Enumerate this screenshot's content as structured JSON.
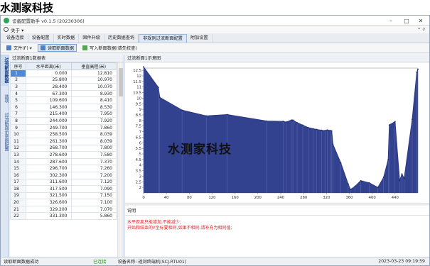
{
  "watermark_top": "水测家科技",
  "watermark_overlay": "水测家科技",
  "window": {
    "title": "设备配置助手 v0.1.5 (20230306)",
    "controls": {
      "minimize": "–",
      "maximize": "□",
      "close": "✕"
    }
  },
  "menu": {
    "about": "关于 ▾",
    "chevron": "⌃  ?"
  },
  "tabs": [
    "设备连接",
    "设备配置",
    "实时数据",
    "固件升级",
    "历史数据查询",
    "非规则过流断面配置",
    "附加设置"
  ],
  "toolbar": {
    "file": "文件(F) ▾",
    "read": "读取断面数据",
    "write": "写入断面数据(请先校查)"
  },
  "vtabs": [
    "过流断面数据",
    "选项",
    "过流断面示意图配置"
  ],
  "table": {
    "panel_title": "过流断面1数据表",
    "headers": [
      "序号",
      "水平距离(米)",
      "垂直高程(米)"
    ],
    "rows": [
      [
        "1",
        "0.000",
        "12.810"
      ],
      [
        "2",
        "25.800",
        "10.970"
      ],
      [
        "3",
        "28.400",
        "10.070"
      ],
      [
        "4",
        "67.300",
        "8.930"
      ],
      [
        "5",
        "109.600",
        "8.410"
      ],
      [
        "6",
        "146.300",
        "8.530"
      ],
      [
        "7",
        "215.400",
        "7.950"
      ],
      [
        "8",
        "244.000",
        "7.920"
      ],
      [
        "9",
        "249.700",
        "7.860"
      ],
      [
        "10",
        "258.500",
        "8.039"
      ],
      [
        "11",
        "261.300",
        "8.039"
      ],
      [
        "12",
        "268.700",
        "7.800"
      ],
      [
        "13",
        "278.600",
        "7.580"
      ],
      [
        "14",
        "287.600",
        "7.370"
      ],
      [
        "15",
        "296.700",
        "7.260"
      ],
      [
        "16",
        "302.300",
        "7.200"
      ],
      [
        "17",
        "311.600",
        "7.120"
      ],
      [
        "18",
        "317.500",
        "7.090"
      ],
      [
        "19",
        "321.500",
        "7.150"
      ],
      [
        "20",
        "326.600",
        "7.100"
      ],
      [
        "21",
        "329.200",
        "7.070"
      ],
      [
        "22",
        "331.300",
        "5.860"
      ]
    ]
  },
  "chart_panel_title": "过流断面1示意图",
  "chart_data": {
    "type": "area",
    "x": [
      0,
      25.8,
      28.4,
      67.3,
      109.6,
      146.3,
      215.4,
      244.0,
      249.7,
      258.5,
      261.3,
      268.7,
      278.6,
      287.6,
      296.7,
      302.3,
      311.6,
      317.5,
      321.5,
      326.6,
      329.2,
      331.3,
      345,
      358,
      362,
      370,
      380,
      395,
      410,
      420,
      428,
      430,
      440,
      448,
      452,
      456,
      470,
      478,
      480
    ],
    "y": [
      12.81,
      10.97,
      10.07,
      8.93,
      8.41,
      8.53,
      7.95,
      7.92,
      7.86,
      8.039,
      8.039,
      7.8,
      7.58,
      7.37,
      7.26,
      7.2,
      7.12,
      7.09,
      7.15,
      7.1,
      7.07,
      5.86,
      4.2,
      2.3,
      1.8,
      2.1,
      2.6,
      2.4,
      2.0,
      2.9,
      4.5,
      7.6,
      7.9,
      2.6,
      3.2,
      2.8,
      8.1,
      12.3,
      12.6
    ],
    "xlim": [
      0,
      480
    ],
    "ylim": [
      1.5,
      12.7
    ],
    "xticks": [
      0,
      40,
      80,
      120,
      160,
      200,
      240,
      280,
      320,
      360,
      400,
      440
    ],
    "yticks": [
      2,
      2.5,
      3,
      3.5,
      4,
      4.5,
      5,
      5.5,
      6,
      6.5,
      7,
      7.5,
      8,
      8.5,
      9,
      9.5,
      10,
      10.5,
      11,
      11.5,
      12,
      12.5
    ],
    "fill_color": "#33428f",
    "line_color": "#2a3a86"
  },
  "description": {
    "title": "说明",
    "lines": [
      "水平距离只能增加,不能减少;",
      "开始和结束的Y坐标要相同,如果不相同,请补充为相同值;"
    ]
  },
  "status": {
    "left": "读取断面数据成功",
    "connected": "已连接",
    "device": "设备名称: 遥测终端机(SCJ-RTU01)",
    "datetime": "2023-03-23 09:19:59"
  }
}
